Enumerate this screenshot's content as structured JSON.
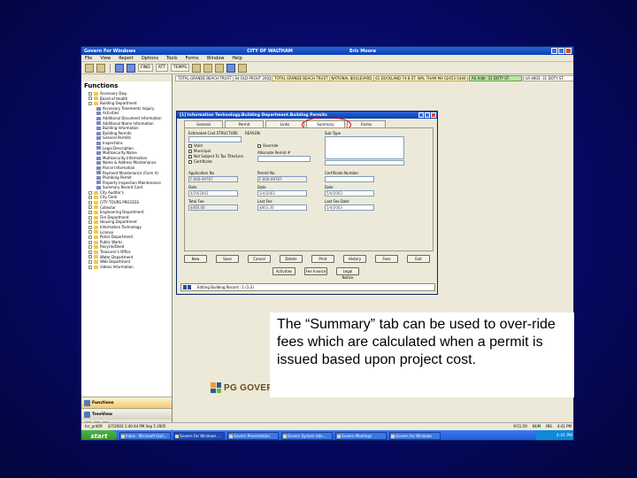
{
  "app": {
    "title": "Govern For Windows",
    "city": "CITY OF WALTHAM",
    "user": "Eric Moore"
  },
  "menu": [
    "File",
    "View",
    "Report",
    "Options",
    "Tools",
    "Forms",
    "Window",
    "Help"
  ],
  "toolbar": {
    "labels": [
      "FIND",
      "ATT",
      "TEMPS"
    ]
  },
  "functions_title": "Functions",
  "tree": [
    {
      "level": 1,
      "kind": "folder",
      "label": "Accessory Dwy."
    },
    {
      "level": 1,
      "kind": "folder",
      "label": "Board of Health"
    },
    {
      "level": 1,
      "kind": "folder",
      "label": "Building Department"
    },
    {
      "level": 2,
      "kind": "item",
      "label": "Accessory Tenements Inquiry"
    },
    {
      "level": 2,
      "kind": "item",
      "label": "Activities"
    },
    {
      "level": 2,
      "kind": "item",
      "label": "Additional Document Information"
    },
    {
      "level": 2,
      "kind": "item",
      "label": "Additional Name Information"
    },
    {
      "level": 2,
      "kind": "item",
      "label": "Building Information"
    },
    {
      "level": 2,
      "kind": "item",
      "label": "Building Permits"
    },
    {
      "level": 2,
      "kind": "item",
      "label": "General Permits"
    },
    {
      "level": 2,
      "kind": "item",
      "label": "Inspections"
    },
    {
      "level": 2,
      "kind": "item",
      "label": "Legal Description"
    },
    {
      "level": 2,
      "kind": "item",
      "label": "Multisecurity Name"
    },
    {
      "level": 2,
      "kind": "item",
      "label": "Multisecurity Information"
    },
    {
      "level": 2,
      "kind": "item",
      "label": "Name & Address Maintenance"
    },
    {
      "level": 2,
      "kind": "item",
      "label": "Parcel Information"
    },
    {
      "level": 2,
      "kind": "item",
      "label": "Payment Maintenance (Form A)"
    },
    {
      "level": 2,
      "kind": "item",
      "label": "Plumbing Permit"
    },
    {
      "level": 2,
      "kind": "item",
      "label": "Property Inspection Maintenance"
    },
    {
      "level": 2,
      "kind": "item",
      "label": "Summary Record Card"
    },
    {
      "level": 1,
      "kind": "folder",
      "label": "City Auditor's"
    },
    {
      "level": 1,
      "kind": "folder",
      "label": "City Clerk"
    },
    {
      "level": 1,
      "kind": "folder",
      "label": "CITY TOURS PROCESS"
    },
    {
      "level": 1,
      "kind": "folder",
      "label": "Collector"
    },
    {
      "level": 1,
      "kind": "folder",
      "label": "Engineering Department"
    },
    {
      "level": 1,
      "kind": "folder",
      "label": "Fire Department"
    },
    {
      "level": 1,
      "kind": "folder",
      "label": "Housing Department"
    },
    {
      "level": 1,
      "kind": "folder",
      "label": "Information Technology"
    },
    {
      "level": 1,
      "kind": "folder",
      "label": "License"
    },
    {
      "level": 1,
      "kind": "folder",
      "label": "Police Department"
    },
    {
      "level": 1,
      "kind": "folder",
      "label": "Public Works"
    },
    {
      "level": 1,
      "kind": "folder",
      "label": "Recycle/Deed"
    },
    {
      "level": 1,
      "kind": "folder",
      "label": "Treasurer's Office"
    },
    {
      "level": 1,
      "kind": "folder",
      "label": "Water Department"
    },
    {
      "level": 1,
      "kind": "folder",
      "label": "Web Department"
    },
    {
      "level": 1,
      "kind": "folder",
      "label": "Videos Information"
    }
  ],
  "nav_buttons": [
    "Search",
    "TreeView",
    "Functions"
  ],
  "address_bar": [
    {
      "style": "plain",
      "text": "TOTAL GRANDE BEACH TRUST | 64 OLD PROUT 2002"
    },
    {
      "style": "yellow",
      "text": "TOTAL GRANDE BEACH TRUST | NATIONAL BOULEVARD | 61 DUCKLAND 74-8 ST. WAL THAM MA 02453-5446"
    },
    {
      "style": "green",
      "text": "AS Addr: 31 DOTY ST."
    },
    {
      "style": "plain",
      "text": "LR 4803: 31 DOTY ST."
    }
  ],
  "dialog": {
    "title": "[1] Information Technology.Building Department.Building Permits",
    "tabs": [
      "General",
      "Permit",
      "Links",
      "Summary",
      "Forms"
    ],
    "active_tab": "Summary",
    "fields": {
      "estimated_label": "Estimated Cost STRUCTURE",
      "reason_label": "REASON",
      "sub_type_label": "Sub Type",
      "estimated_value": "",
      "check_1": "Valid",
      "check_2": "Municipal",
      "check_3": "Not Subject To Tax Title/Lien",
      "check_4": "Certificate",
      "check_5": "Override",
      "alternate_label": "Alternate Permit #",
      "application_no_label": "Application No",
      "application_no": "F-000-09767",
      "permit_no_label": "Permit No",
      "permit_no": "F-000-09767",
      "cert_no_label": "Certificate Number",
      "date_label_1": "Date",
      "date_1": "4/29/2003",
      "date_label_2": "Date",
      "date_2": "5/4/2003",
      "date_label_3": "Date",
      "date_3": "5/4/2003",
      "total_fee_label": "Total Fee",
      "total_fee": "$400.00",
      "last_fee_label": "Last Fee",
      "last_fee": "$803.30",
      "last_fee_date_label": "Last Fee Date",
      "last_fee_date": "5/4/2003"
    },
    "buttons_row1": [
      "New",
      "Save",
      "Cancel",
      "Delete",
      "Print",
      "History",
      "Fees",
      "Exit"
    ],
    "buttons_row2": [
      "Activities",
      "Fee Invoice",
      "Legal Notice"
    ],
    "status_text": "Editing Building Record : 1 (1-2)"
  },
  "logo_text": "PG GOVERN",
  "caption": "The “Summary” tab can be used to over-ride fees which are calculated when a permit is issued based upon project cost.",
  "status_bar": {
    "user": "hrr_prd09",
    "datetime": "3/7/2003 1:40:44 PM Sep 5 2005",
    "right": [
      "9:51:59",
      "NUM",
      "INS",
      "4:41 PM"
    ]
  },
  "taskbar": {
    "start": "start",
    "tasks": [
      "Inbox - Microsoft Outl...",
      "Govern For Windows ...",
      "Govern Presentation",
      "Govern System Ade...",
      "Govern Meetings",
      "Govern For Windows"
    ],
    "clock": "4:41 PM"
  }
}
